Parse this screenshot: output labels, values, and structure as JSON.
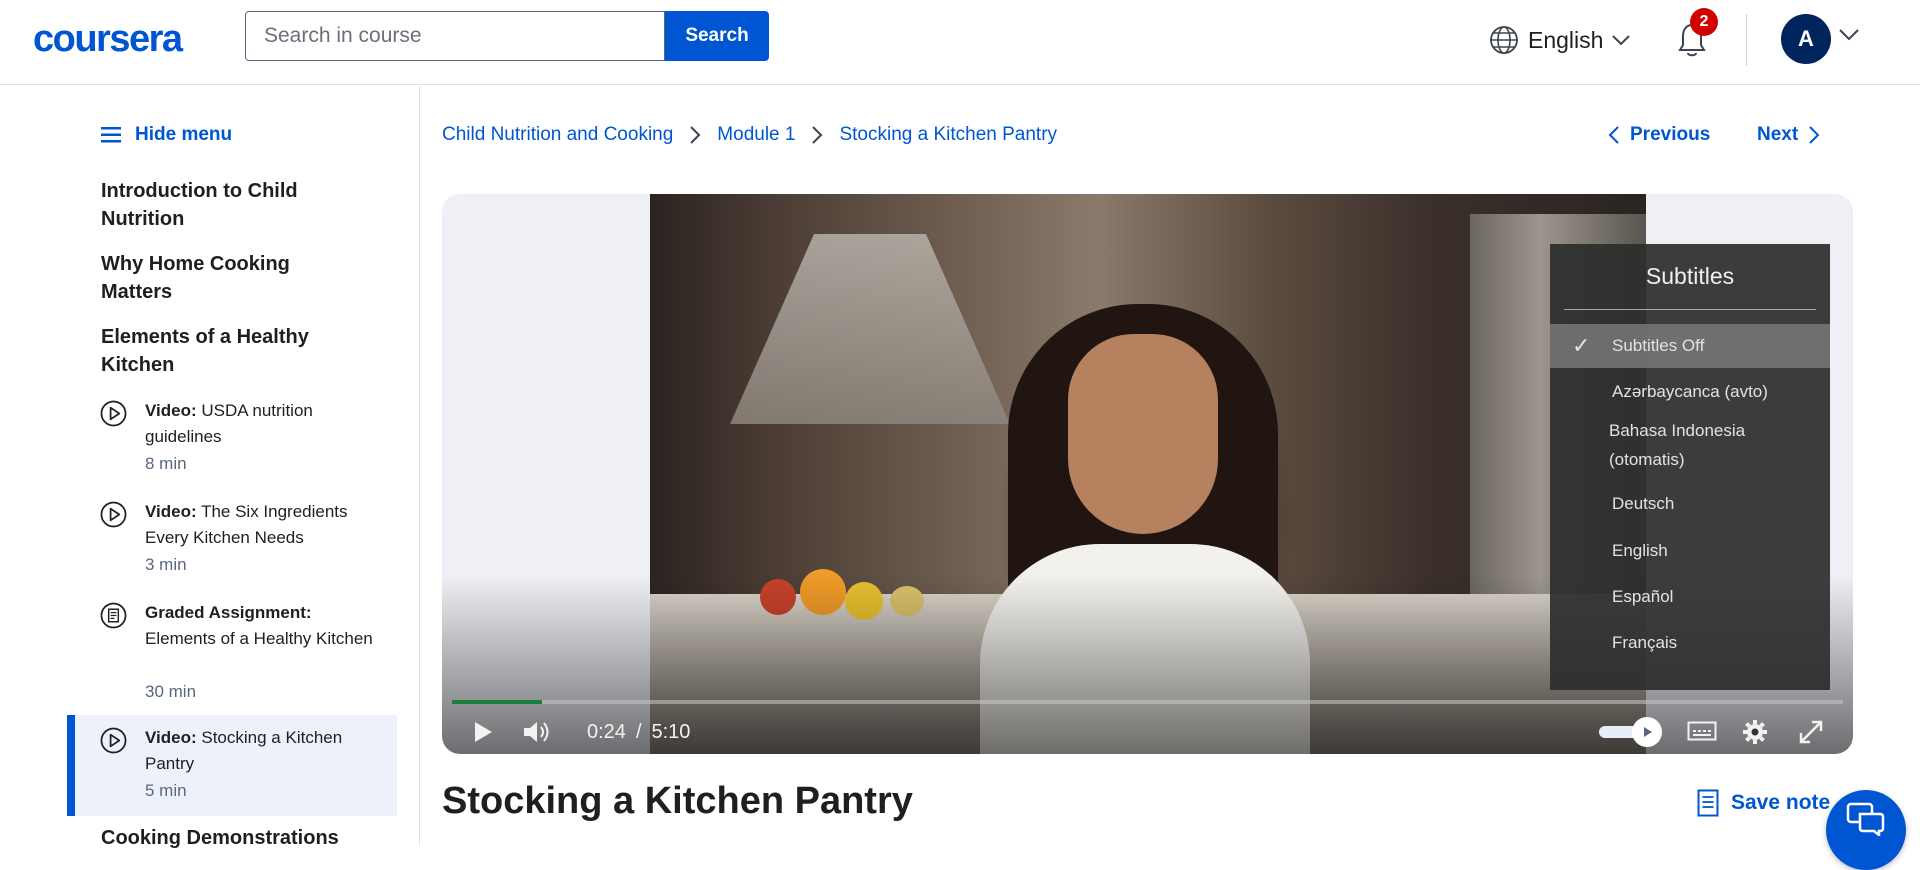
{
  "header": {
    "logo": "coursera",
    "search_placeholder": "Search in course",
    "search_button": "Search",
    "language": "English",
    "notification_count": "2",
    "avatar_initial": "A"
  },
  "sidebar": {
    "hide_menu": "Hide menu",
    "sections": [
      "Introduction to Child Nutrition",
      "Why Home Cooking Matters",
      "Elements of a Healthy Kitchen"
    ],
    "items": [
      {
        "type_label": "Video:",
        "title": "USDA nutrition guidelines",
        "duration": "8 min",
        "icon": "play-circle-icon"
      },
      {
        "type_label": "Video:",
        "title": "The Six Ingredients Every Kitchen Needs",
        "duration": "3 min",
        "icon": "play-circle-icon"
      },
      {
        "type_label": "Graded Assignment:",
        "title": "Elements of a Healthy Kitchen",
        "duration": "30 min",
        "icon": "assignment-icon"
      },
      {
        "type_label": "Video:",
        "title": "Stocking a Kitchen Pantry",
        "duration": "5 min",
        "icon": "play-circle-icon",
        "active": true
      }
    ],
    "next_section": "Cooking Demonstrations"
  },
  "breadcrumb": [
    "Child Nutrition and Cooking",
    "Module 1",
    "Stocking a Kitchen Pantry"
  ],
  "nav": {
    "previous": "Previous",
    "next": "Next"
  },
  "player": {
    "subtitles_menu": {
      "title": "Subtitles",
      "options": [
        "Subtitles Off",
        "Azərbaycanca (avto)",
        "Bahasa Indonesia (otomatis)",
        "Deutsch",
        "English",
        "Español",
        "Français"
      ],
      "selected": "Subtitles Off"
    },
    "current_time": "0:24",
    "time_separator": "/",
    "duration": "5:10",
    "progress_percent": 6.5
  },
  "main": {
    "title": "Stocking a Kitchen Pantry",
    "save_note": "Save note"
  },
  "colors": {
    "brand": "#0056d2",
    "active_bg": "#edf2fa",
    "progress": "#1a7f37",
    "badge": "#d30001"
  }
}
